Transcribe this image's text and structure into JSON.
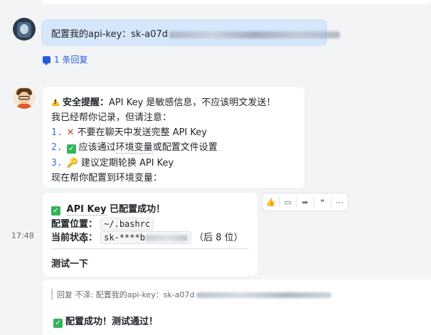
{
  "user_message": {
    "text": "配置我的api-key：sk-a07d",
    "reply_count": "1 条回复"
  },
  "bot_message": {
    "warning_title": "安全提醒：",
    "warning_body": "API Key 是敏感信息，不应该明文发送！",
    "intro": "我已经帮你记录，但请注意：",
    "items": [
      {
        "num": "1.",
        "icon": "cross-icon",
        "text": "不要在聊天中发送完整 API Key"
      },
      {
        "num": "2.",
        "icon": "check-icon",
        "text_before": "应该通过",
        "text_dotted": "环境变量",
        "text_after": "或配置文件设置"
      },
      {
        "num": "3.",
        "icon": "key-icon",
        "text": "建议定期轮换 API Key"
      }
    ],
    "outro": "现在帮你配置到环境变量："
  },
  "config_card": {
    "title_dotted": "API Key",
    "title_rest": " 已配置成功！",
    "location_label": "配置位置：",
    "location_value": "~/.bashrc",
    "status_label": "当前状态：",
    "status_value": "sk-****b",
    "status_suffix": "（后 8 位）",
    "action": "测试一下",
    "timestamp": "17:48"
  },
  "reply": {
    "quote": "回复 不泽: 配置我的api-key：sk-a07d",
    "text": "配置成功！测试通过！"
  },
  "colors": {
    "user_bubble": "#d6e6fb",
    "link": "#245bdb",
    "success": "#34b35a",
    "warning": "#f7ba1e",
    "error": "#e03a3a"
  }
}
